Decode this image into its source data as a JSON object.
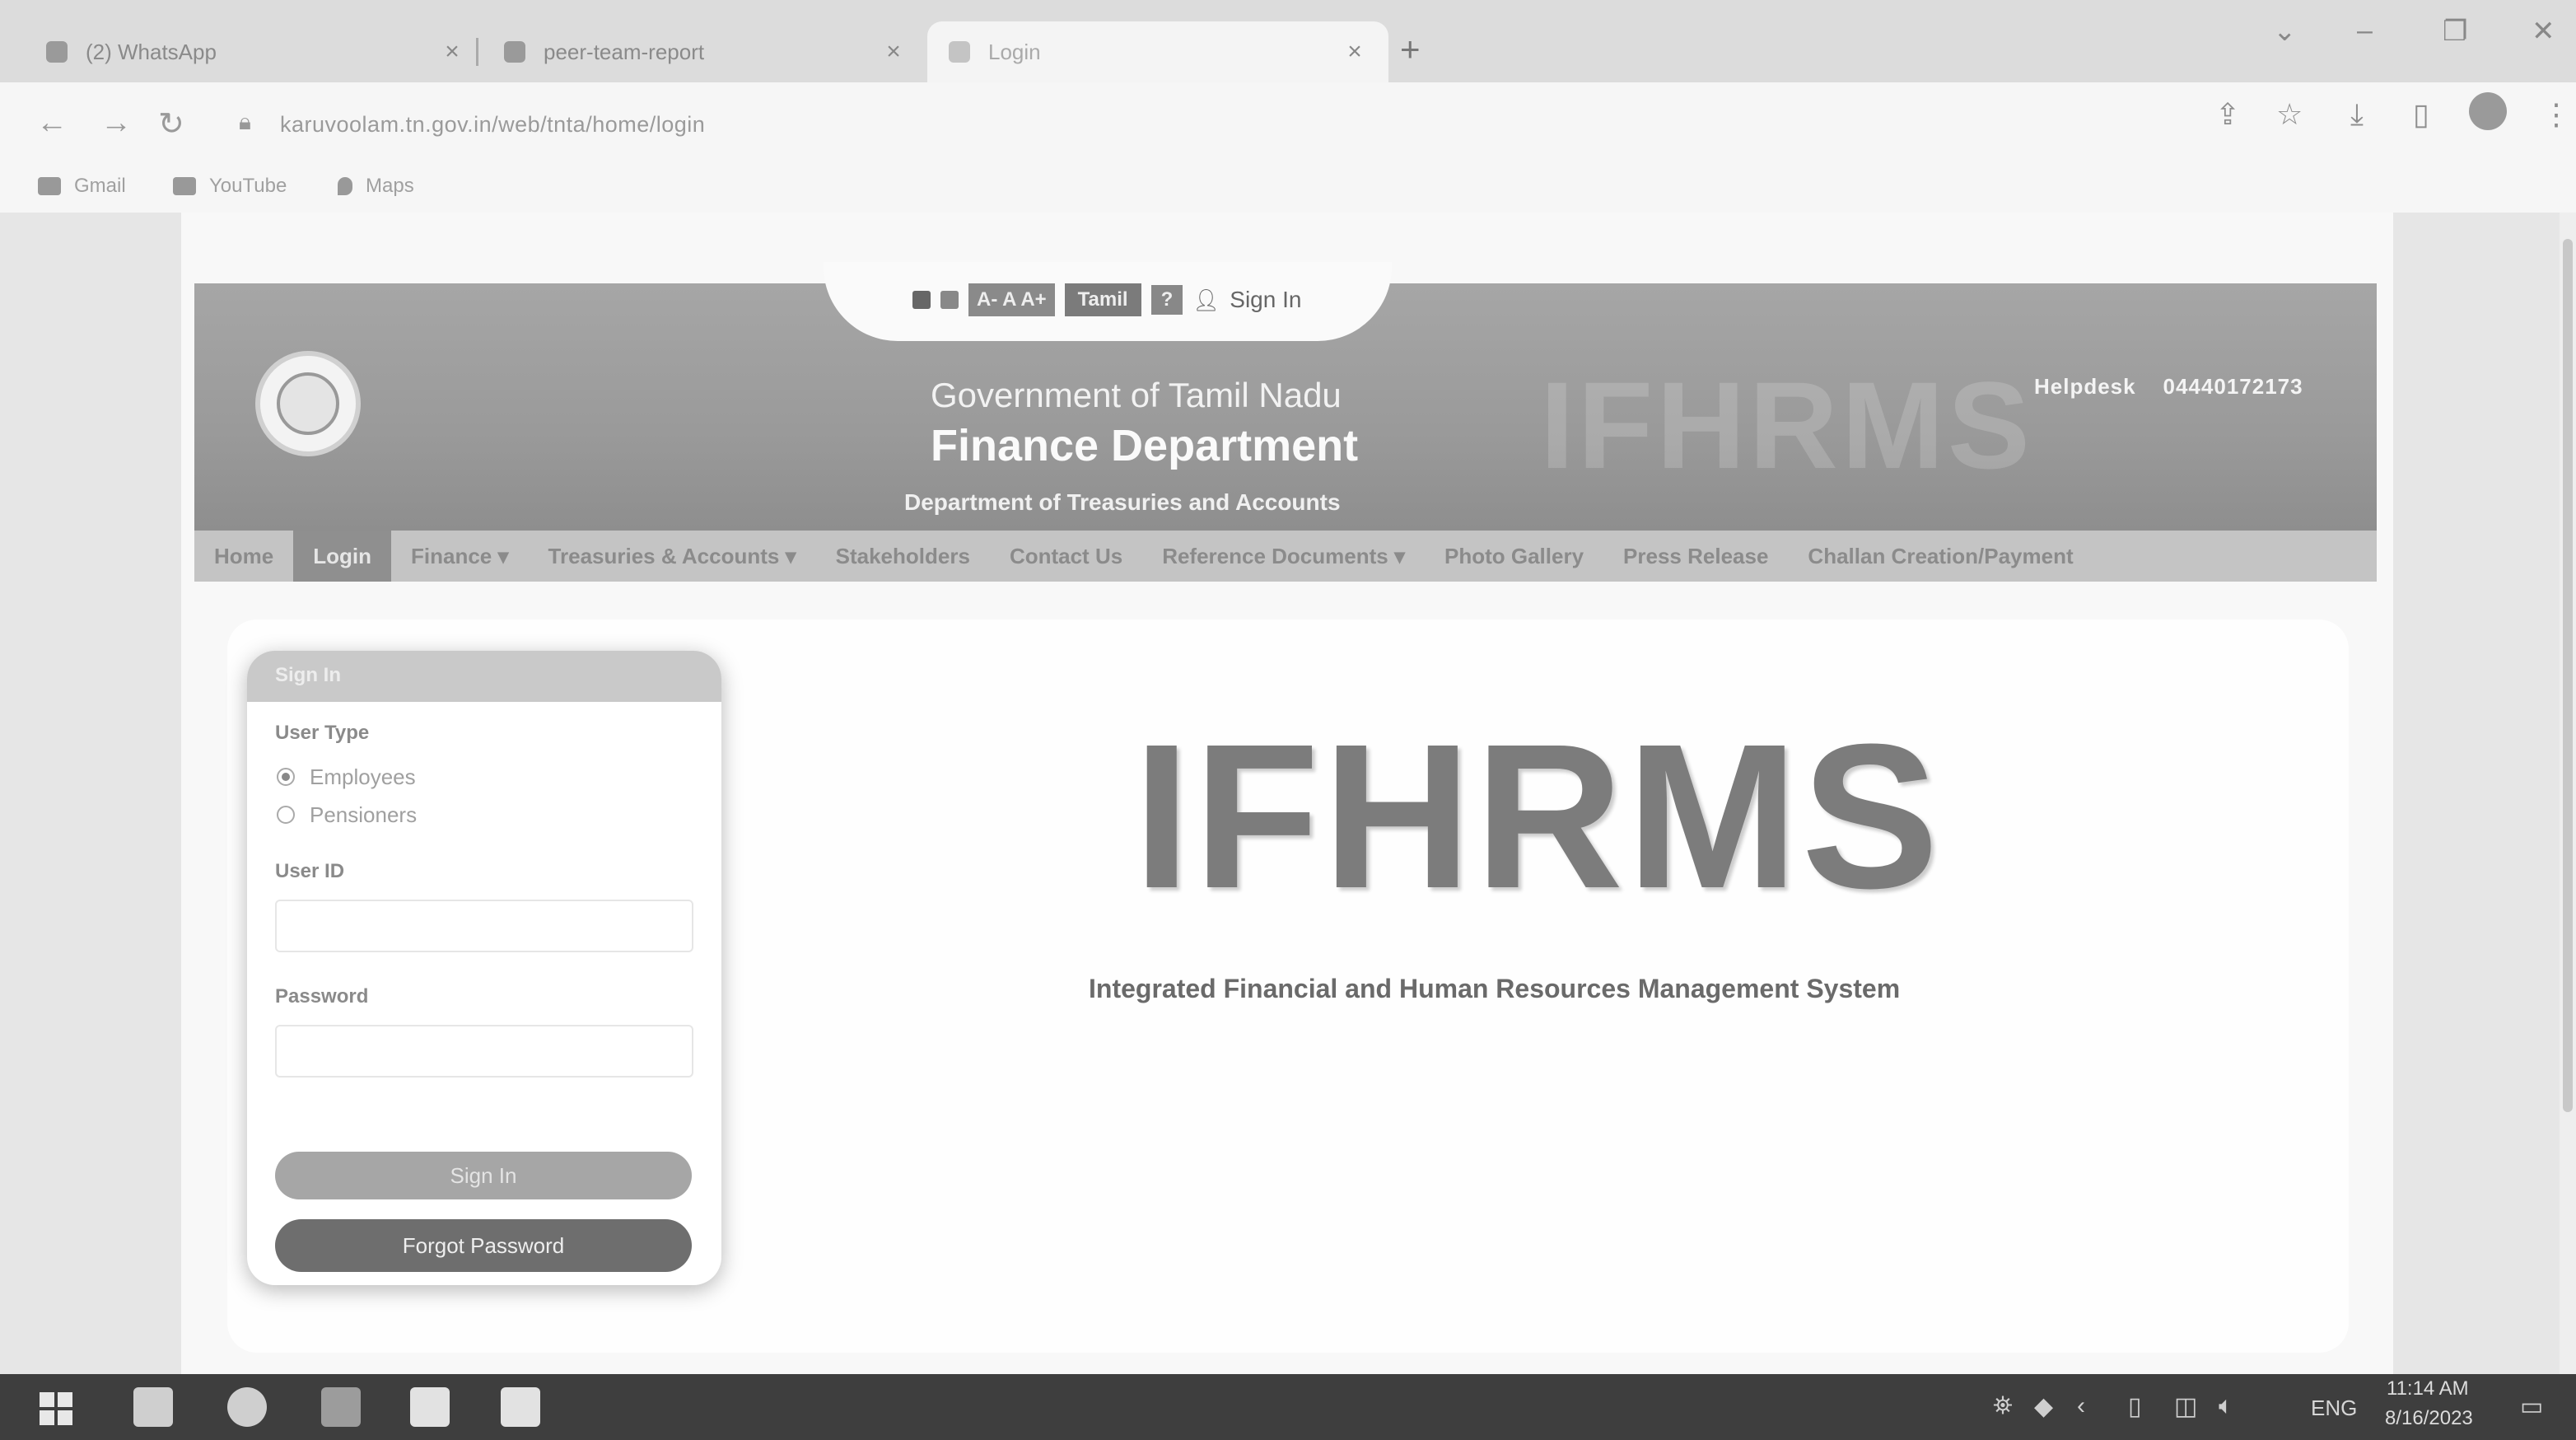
{
  "browser": {
    "tabs": [
      {
        "title": "(2) WhatsApp",
        "close": "×"
      },
      {
        "title": "peer-team-report",
        "close": "×"
      },
      {
        "title": "Login",
        "close": "×"
      }
    ],
    "new_tab": "+",
    "window_controls": {
      "chevron": "⌄",
      "minimize": "–",
      "restore": "❐",
      "close": "✕"
    },
    "nav": {
      "back": "←",
      "forward": "→",
      "reload": "↻"
    },
    "url": "karuvoolam.tn.gov.in/web/tnta/home/login",
    "toolbar_icons": {
      "share": "⇪",
      "star": "☆",
      "download": "⤓",
      "sidepanel": "▯",
      "menu": "⋮"
    },
    "bookmarks": [
      "Gmail",
      "YouTube",
      "Maps"
    ]
  },
  "site": {
    "access_bar": {
      "font_sizes": "A- A A+",
      "language": "Tamil",
      "help": "?",
      "signin": "Sign In"
    },
    "header": {
      "line1": "Government of Tamil Nadu",
      "line2": "Finance Department",
      "line3": "Department of Treasuries and Accounts",
      "watermark": "IFHRMS",
      "helpdesk_label": "Helpdesk",
      "helpdesk_number": "04440172173"
    },
    "nav_items": [
      "Home",
      "Login",
      "Finance ▾",
      "Treasuries & Accounts ▾",
      "Stakeholders",
      "Contact Us",
      "Reference Documents ▾",
      "Photo Gallery",
      "Press Release",
      "Challan Creation/Payment"
    ],
    "active_nav": "Login"
  },
  "signin_panel": {
    "title": "Sign In",
    "user_type_label": "User Type",
    "options": [
      {
        "label": "Employees",
        "selected": true
      },
      {
        "label": "Pensioners",
        "selected": false
      }
    ],
    "user_id_label": "User ID",
    "user_id_value": "",
    "password_label": "Password",
    "password_value": "",
    "signin_button": "Sign In",
    "forgot_button": "Forgot Password"
  },
  "hero": {
    "title": "IFHRMS",
    "subtitle": "Integrated Financial and Human Resources Management System"
  },
  "taskbar": {
    "language": "ENG",
    "time": "11:14 AM",
    "date": "8/16/2023"
  }
}
